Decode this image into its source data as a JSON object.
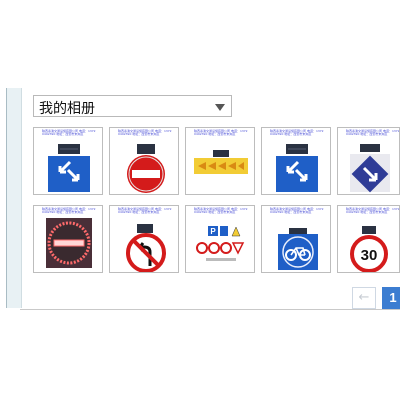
{
  "album": {
    "selected": "我的相册"
  },
  "thumb_caption": "陕西秦澳交通设施有限公司 电话：13720492390 地址：西安市未央区",
  "photos": [
    {
      "name": "solar-two-arrows-blue-sign"
    },
    {
      "name": "solar-no-entry-red-sign"
    },
    {
      "name": "solar-yellow-arrow-board"
    },
    {
      "name": "solar-two-arrows-blue-sign"
    },
    {
      "name": "solar-keep-right-sign"
    },
    {
      "name": "led-no-entry-ring-sign"
    },
    {
      "name": "solar-no-left-turn-sign"
    },
    {
      "name": "sign-product-collection"
    },
    {
      "name": "solar-bicycle-lane-sign"
    },
    {
      "name": "solar-speed-limit-30-sign",
      "text": "30"
    }
  ],
  "pagination": {
    "prev": "←",
    "current": "1"
  },
  "colors": {
    "sign_blue": "#1f5fc7",
    "sign_red": "#d41b1b",
    "sign_yellow": "#f2cc35",
    "accent": "#3c7dd1"
  }
}
